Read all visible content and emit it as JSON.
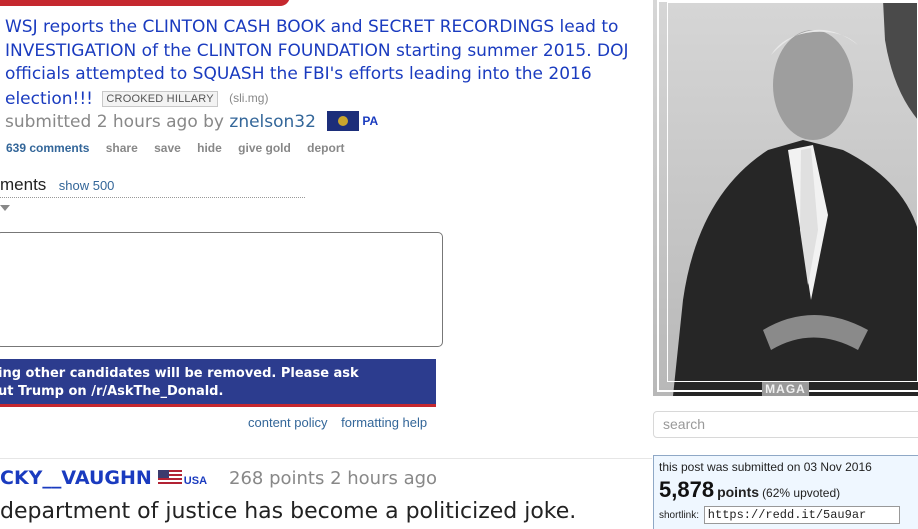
{
  "post": {
    "title": "WSJ reports the CLINTON CASH BOOK and SECRET RECORDINGS lead to INVESTIGATION of the CLINTON FOUNDATION starting summer 2015. DOJ officials attempted to SQUASH the FBI's efforts leading into the 2016 election!!!",
    "flair": "CROOKED HILLARY",
    "domain": "(sli.mg)",
    "submitted_prefix": "submitted 2 hours ago by",
    "author": "znelson32",
    "author_flair": "PA",
    "actions": {
      "comments": "639 comments",
      "share": "share",
      "save": "save",
      "hide": "hide",
      "give_gold": "give gold",
      "deport": "deport"
    }
  },
  "comments_area": {
    "header": "ments",
    "show_more": "show 500",
    "notice_line1": "ing other candidates will be removed. Please ask",
    "notice_line2": "ut Trump on /r/AskThe_Donald.",
    "content_policy": "content policy",
    "formatting_help": "formatting help"
  },
  "comment": {
    "author": "CKY__VAUGHN",
    "author_flair": "USA",
    "meta": "268 points 2 hours ago",
    "body": "department of justice has become a politicized joke."
  },
  "sidebar": {
    "banner_caption": "MAGA",
    "search_placeholder": "search",
    "submitted_date": "this post was submitted on 03 Nov 2016",
    "points": "5,878",
    "points_label": "points",
    "upvoted": "(62% upvoted)",
    "shortlink_label": "shortlink:",
    "shortlink_value": "https://redd.it/5au9ar"
  },
  "colors": {
    "link_blue": "#1a3bbf",
    "accent_red": "#c5282f",
    "navy": "#2c3c8e"
  }
}
